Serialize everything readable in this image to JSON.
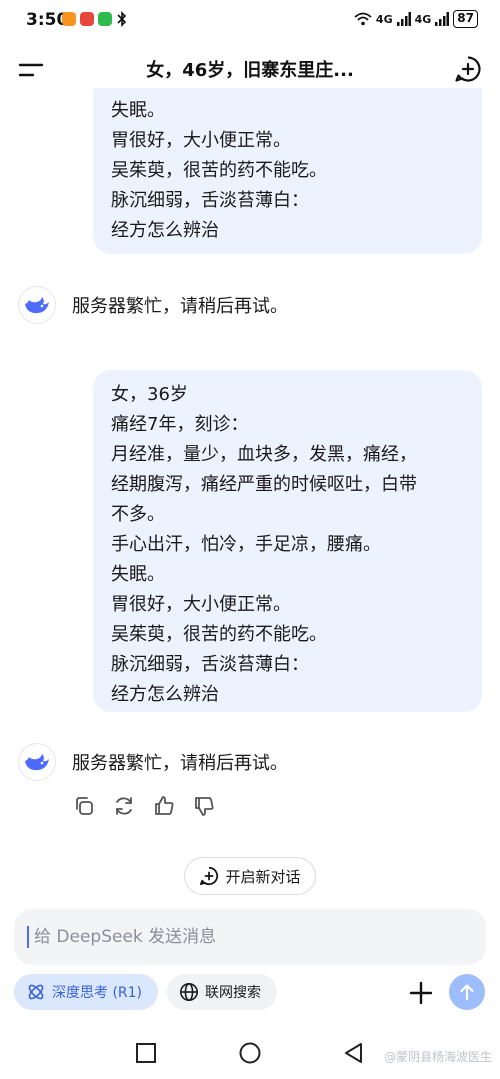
{
  "status_bar": {
    "time": "3:50",
    "signal_1": "4G",
    "signal_2": "4G",
    "battery": "87"
  },
  "header": {
    "title": "女，46岁，旧寨东里庄..."
  },
  "messages": {
    "user_1_lines": [
      "失眠。",
      "胃很好，大小便正常。",
      "吴茱萸，很苦的药不能吃。",
      "脉沉细弱，舌淡苔薄白：",
      "经方怎么辨治"
    ],
    "ai_1": "服务器繁忙，请稍后再试。",
    "user_2_lines": [
      "女，36岁",
      "痛经7年，刻诊：",
      "月经准，量少，血块多，发黑，痛经，",
      "经期腹泻，痛经严重的时候呕吐，白带",
      "不多。",
      "手心出汗，怕冷，手足凉，腰痛。",
      "失眠。",
      "胃很好，大小便正常。",
      "吴茱萸，很苦的药不能吃。",
      "脉沉细弱，舌淡苔薄白：",
      "经方怎么辨治"
    ],
    "ai_2": "服务器繁忙，请稍后再试。"
  },
  "new_dialog_label": "开启新对话",
  "input": {
    "placeholder": "给 DeepSeek 发送消息"
  },
  "chips": {
    "deep_think": "深度思考 (R1)",
    "web_search": "联网搜索"
  },
  "watermark": "@蒙阴县杨海波医生",
  "colors": {
    "accent": "#4d6bfe",
    "bubble": "#edf3fe",
    "send": "#9dbcfb"
  }
}
